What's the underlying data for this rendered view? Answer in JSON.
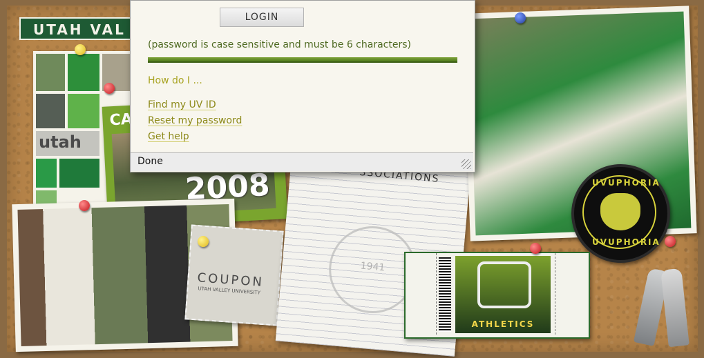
{
  "banner": {
    "title": "UTAH VAL"
  },
  "campus_card": {
    "label": "CA"
  },
  "collage": {
    "label": "utah"
  },
  "year": "2008",
  "coupon": {
    "word": "COUPON",
    "sub": "UTAH VALLEY UNIVERSITY"
  },
  "notepad": {
    "header": "SSOCIATIONS",
    "seal_text": "1941"
  },
  "badge": {
    "top_text": "UVUPHORIA",
    "bottom_text": "UVUPHORIA"
  },
  "ticket": {
    "text": "ATHLETICS"
  },
  "popup": {
    "login_label": "LOGIN",
    "hint": "(password is case sensitive and must be 6 characters)",
    "how_do_i": "How do I ...",
    "links": [
      "Find my UV ID",
      "Reset my password",
      "Get help"
    ],
    "status": "Done"
  },
  "colors": {
    "accent_green": "#4f7b1d",
    "link_olive": "#8d8a1a"
  }
}
